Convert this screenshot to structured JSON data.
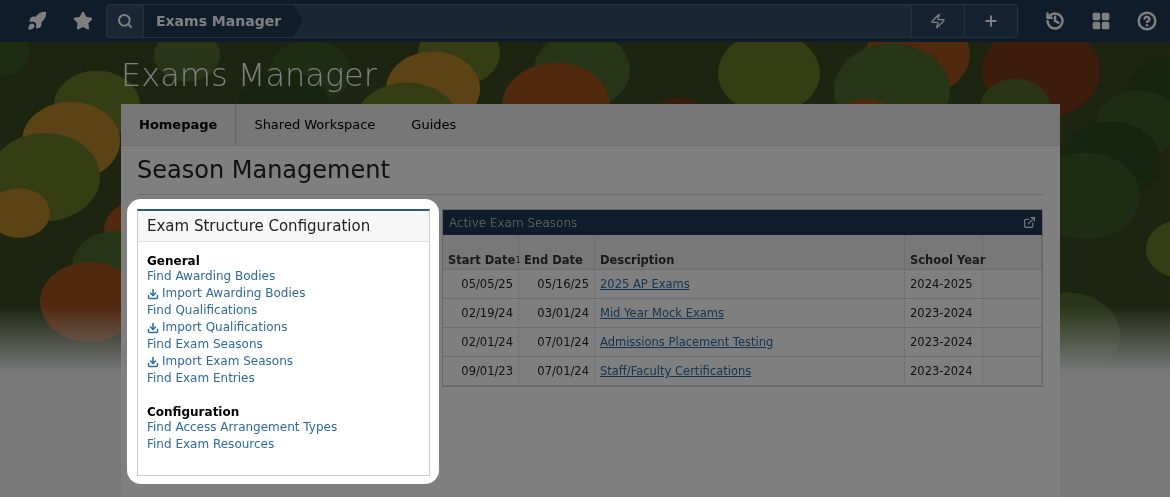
{
  "top_bar": {
    "breadcrumb": "Exams Manager"
  },
  "app_title": "Exams Manager",
  "tabs": [
    {
      "label": "Homepage",
      "selected": true
    },
    {
      "label": "Shared Workspace",
      "selected": false
    },
    {
      "label": "Guides",
      "selected": false
    }
  ],
  "page_title": "Season Management",
  "config_card": {
    "title": "Exam Structure Configuration",
    "highlighted": true,
    "sections": [
      {
        "heading": "General",
        "links": [
          {
            "label": "Find Awarding Bodies",
            "kind": "find"
          },
          {
            "label": "Import Awarding Bodies",
            "kind": "import"
          },
          {
            "label": "Find Qualifications",
            "kind": "find"
          },
          {
            "label": "Import Qualifications",
            "kind": "import"
          },
          {
            "label": "Find Exam Seasons",
            "kind": "find"
          },
          {
            "label": "Import Exam Seasons",
            "kind": "import"
          },
          {
            "label": "Find Exam Entries",
            "kind": "find"
          }
        ]
      },
      {
        "heading": "Configuration",
        "links": [
          {
            "label": "Find Access Arrangement Types",
            "kind": "find"
          },
          {
            "label": "Find Exam Resources",
            "kind": "find"
          }
        ]
      }
    ]
  },
  "seasons": {
    "title": "Active Exam Seasons",
    "sort_rank": "1",
    "columns": [
      "Start Date",
      "End Date",
      "Description",
      "School Year"
    ],
    "rows": [
      {
        "start": "05/05/25",
        "end": "05/16/25",
        "description": "2025 AP Exams",
        "year": "2024-2025"
      },
      {
        "start": "02/19/24",
        "end": "03/01/24",
        "description": "Mid Year Mock Exams",
        "year": "2023-2024"
      },
      {
        "start": "02/01/24",
        "end": "07/01/24",
        "description": "Admissions Placement Testing",
        "year": "2023-2024"
      },
      {
        "start": "09/01/23",
        "end": "07/01/24",
        "description": "Staff/Faculty Certifications",
        "year": "2023-2024"
      }
    ]
  }
}
